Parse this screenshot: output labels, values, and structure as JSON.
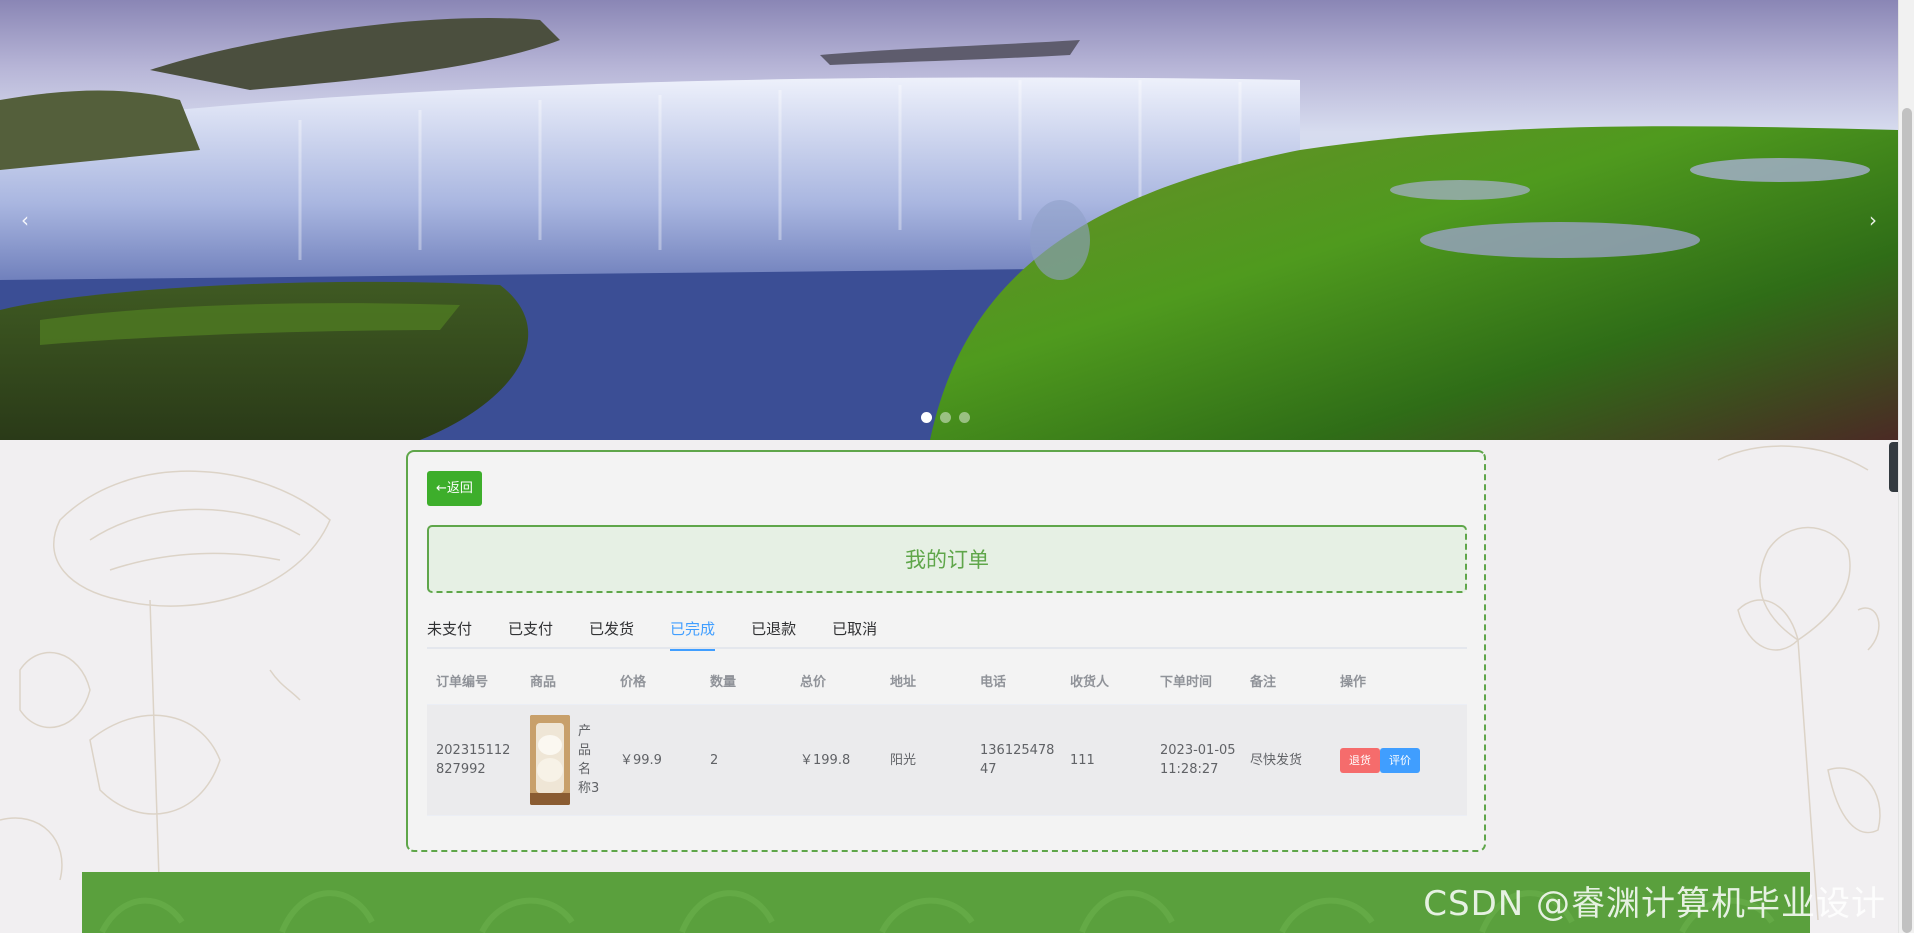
{
  "carousel": {
    "prev_icon": "chevron-left-icon",
    "next_icon": "chevron-right-icon",
    "prev_glyph": "‹",
    "next_glyph": "›",
    "slide_count": 3,
    "active_slide": 1
  },
  "side_toggle": {
    "icon": "chevron-left-icon",
    "glyph": "‹"
  },
  "card": {
    "back_label": "←返回",
    "title": "我的订单",
    "tabs": [
      {
        "label": "未支付",
        "active": false
      },
      {
        "label": "已支付",
        "active": false
      },
      {
        "label": "已发货",
        "active": false
      },
      {
        "label": "已完成",
        "active": true
      },
      {
        "label": "已退款",
        "active": false
      },
      {
        "label": "已取消",
        "active": false
      }
    ],
    "table": {
      "headers": [
        "订单编号",
        "商品",
        "价格",
        "数量",
        "总价",
        "地址",
        "电话",
        "收货人",
        "下单时间",
        "备注",
        "操作"
      ],
      "rows": [
        {
          "order_no": "202315112827992",
          "goods_name": "产品名称3",
          "price": "￥99.9",
          "qty": "2",
          "total": "￥199.8",
          "address": "阳光",
          "phone": "13612547847",
          "receiver": "111",
          "time": "2023-01-05 11:28:27",
          "remark": "尽快发货",
          "refund_label": "退货",
          "review_label": "评价"
        }
      ]
    }
  },
  "watermark": "CSDN @睿渊计算机毕业设计",
  "colors": {
    "accent_green": "#5fa64a",
    "button_green": "#3dae2b",
    "tab_active": "#409eff",
    "danger": "#f56c6c",
    "footer": "#5aa03d"
  }
}
